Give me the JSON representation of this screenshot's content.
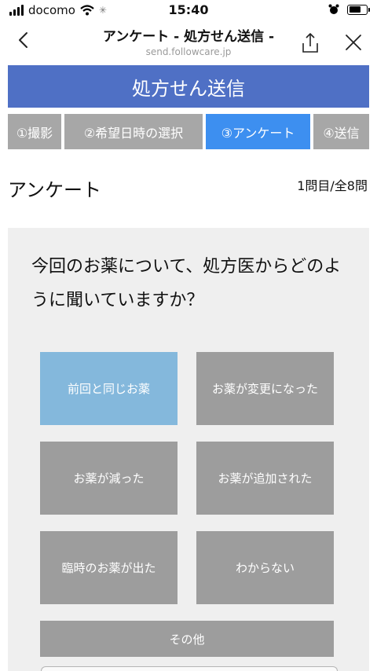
{
  "status_bar": {
    "carrier": "docomo",
    "time": "15:40"
  },
  "nav": {
    "title": "アンケート - 処方せん送信 -",
    "url": "send.followcare.jp"
  },
  "banner": {
    "title": "処方せん送信"
  },
  "steps": [
    {
      "label": "①撮影",
      "active": false
    },
    {
      "label": "②希望日時の選択",
      "active": false
    },
    {
      "label": "③アンケート",
      "active": true
    },
    {
      "label": "④送信",
      "active": false
    }
  ],
  "survey": {
    "heading": "アンケート",
    "progress": "1問目/全8問",
    "question": "今回のお薬について、処方医からどのように聞いていますか？",
    "answers": [
      {
        "label": "前回と同じお薬",
        "selected": true
      },
      {
        "label": "お薬が変更になった",
        "selected": false
      },
      {
        "label": "お薬が減った",
        "selected": false
      },
      {
        "label": "お薬が追加された",
        "selected": false
      },
      {
        "label": "臨時のお薬が出た",
        "selected": false
      },
      {
        "label": "わからない",
        "selected": false
      },
      {
        "label": "その他",
        "selected": false
      }
    ]
  },
  "colors": {
    "banner": "#4f70c5",
    "step_active": "#3d8ff0",
    "step_inactive": "#a7a7a7",
    "answer_selected": "#84b8dc",
    "answer_default": "#9d9d9d",
    "panel": "#efefef"
  }
}
